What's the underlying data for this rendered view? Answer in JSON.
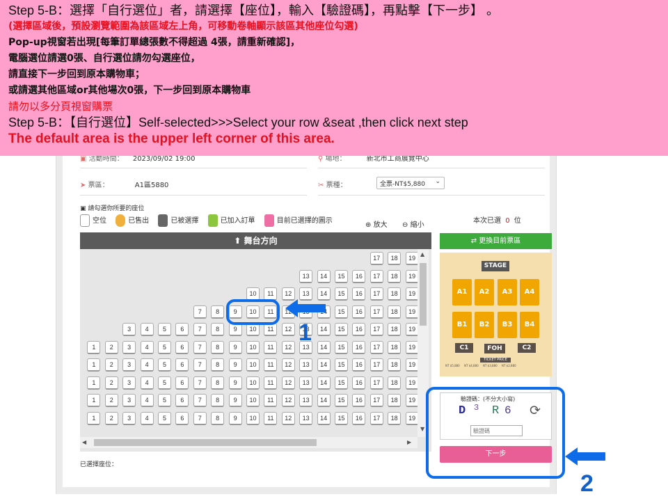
{
  "banner": {
    "line1": "Step 5-B：選擇「自行選位」者，請選擇【座位】，輸入【驗證碼】，再點擊【下一步】 。",
    "line2": "(選擇區域後，預設瀏覽範圍為該區域左上角，可移動卷軸顯示該區其他座位勾選)",
    "line3": "Pop-up視窗若出現[每筆訂單總張數不得超過 4張，請重新確認]，",
    "line4": "電腦選位請選0張、自行選位請勿勾選座位，",
    "line5": "請直接下一步回到原本購物車；",
    "line6": "或請選其他區域or其他場次0張，下一步回到原本購物車",
    "line7": "請勿以多分頁視窗購票",
    "line8": "Step 5-B：【自行選位】Self-selected>>>Select   your row &seat ,then click  next step",
    "line9": "The default area is the upper left corner of this area."
  },
  "info": {
    "date_label": "活動時間：",
    "date_value": "2023/09/02  19:00",
    "venue_label": "場地：",
    "venue_value": "新北市工商展覽中心",
    "area_label": "票區：",
    "area_value": "A1區5880",
    "type_label": "票種：",
    "type_value": "全票-NT$5,880"
  },
  "legend": {
    "hint": "請勾選你所要的座位",
    "empty": "空位",
    "sold": "已售出",
    "selected": "已被選擇",
    "in_order": "已加入訂單",
    "current": "目前已選擇的圖示",
    "zoom_in": "放大",
    "zoom_out": "縮小",
    "count_prefix": "本次已選",
    "count_value": "0",
    "count_suffix": "位"
  },
  "stage_label": "舞台方向",
  "seat_rows": [
    {
      "nums": [
        "17",
        "18",
        "19"
      ]
    },
    {
      "nums": [
        "13",
        "14",
        "15",
        "16",
        "17",
        "18",
        "19"
      ]
    },
    {
      "nums": [
        "10",
        "11",
        "12",
        "13",
        "14",
        "15",
        "16",
        "17",
        "18",
        "19"
      ]
    },
    {
      "nums": [
        "7",
        "8",
        "9",
        "10",
        "11",
        "12",
        "13",
        "14",
        "15",
        "16",
        "17",
        "18",
        "19"
      ]
    },
    {
      "nums": [
        "3",
        "4",
        "5",
        "6",
        "7",
        "8",
        "9",
        "10",
        "11",
        "12",
        "13",
        "14",
        "15",
        "16",
        "17",
        "18",
        "19"
      ]
    },
    {
      "nums": [
        "1",
        "2",
        "3",
        "4",
        "5",
        "6",
        "7",
        "8",
        "9",
        "10",
        "11",
        "12",
        "13",
        "14",
        "15",
        "16",
        "17",
        "18",
        "19"
      ]
    },
    {
      "nums": [
        "1",
        "2",
        "3",
        "4",
        "5",
        "6",
        "7",
        "8",
        "9",
        "10",
        "11",
        "12",
        "13",
        "14",
        "15",
        "16",
        "17",
        "18",
        "19"
      ]
    },
    {
      "nums": [
        "1",
        "2",
        "3",
        "4",
        "5",
        "6",
        "7",
        "8",
        "9",
        "10",
        "11",
        "12",
        "13",
        "14",
        "15",
        "16",
        "17",
        "18",
        "19"
      ]
    },
    {
      "nums": [
        "1",
        "2",
        "3",
        "4",
        "5",
        "6",
        "7",
        "8",
        "9",
        "10",
        "11",
        "12",
        "13",
        "14",
        "15",
        "16",
        "17",
        "18",
        "19"
      ]
    },
    {
      "nums": [
        "1",
        "2",
        "3",
        "4",
        "5",
        "6",
        "7",
        "8",
        "9",
        "10",
        "11",
        "12",
        "13",
        "14",
        "15",
        "16",
        "17",
        "18",
        "19"
      ]
    }
  ],
  "selected_seats_label": "已選擇座位：",
  "side": {
    "change_area": "更換目前票區",
    "stage": "STAGE",
    "blocks": [
      "A1",
      "A2",
      "A3",
      "A4",
      "B1",
      "B2",
      "B3",
      "B4",
      "C1",
      "FOH",
      "C2"
    ],
    "ticket_price": "TICKET PRICE",
    "prices": [
      "NT $5,880",
      "NT $4,880",
      "NT $3,880",
      "NT $2,880"
    ],
    "captcha_label": "驗證碼：(不分大小寫)",
    "captcha_chars": [
      "D",
      "3",
      "R",
      "6"
    ],
    "captcha_placeholder": "驗證碼",
    "next_button": "下一步"
  },
  "annotations": {
    "n1": "1",
    "n2": "2"
  },
  "colors": {
    "banner": "#ffa0cc",
    "highlight": "#0e6ce8",
    "accent_red": "#e8101e",
    "green": "#3cab3c",
    "next": "#e85f95",
    "area_block": "#f0a500"
  }
}
